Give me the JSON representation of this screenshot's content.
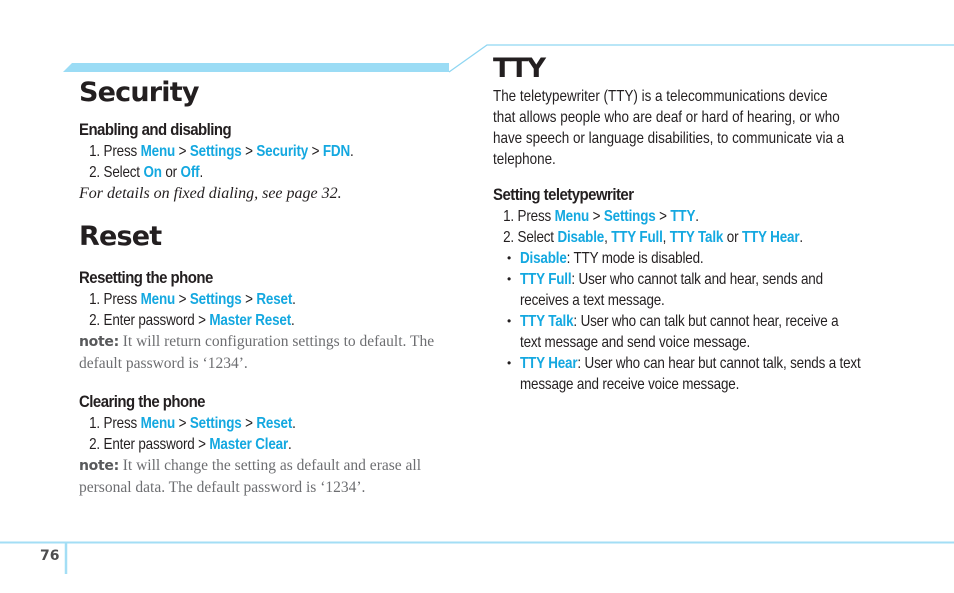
{
  "colors": {
    "accent": "#14a8e0",
    "band": "#9bdcf5",
    "rule": "#8fd6f2",
    "text": "#231f20",
    "note_text": "#6d6e71"
  },
  "left": {
    "security": {
      "title": "Security",
      "subsections": [
        {
          "heading": "Enabling and disabling",
          "steps": [
            {
              "num": "1.",
              "parts": [
                {
                  "t": "Press ",
                  "hl": false
                },
                {
                  "t": "Menu",
                  "hl": true
                },
                {
                  "t": " > ",
                  "hl": false
                },
                {
                  "t": "Settings",
                  "hl": true
                },
                {
                  "t": " > ",
                  "hl": false
                },
                {
                  "t": "Security",
                  "hl": true
                },
                {
                  "t": " > ",
                  "hl": false
                },
                {
                  "t": "FDN",
                  "hl": true
                },
                {
                  "t": ".",
                  "hl": false
                }
              ]
            },
            {
              "num": "2.",
              "parts": [
                {
                  "t": "Select ",
                  "hl": false
                },
                {
                  "t": "On",
                  "hl": true
                },
                {
                  "t": " or ",
                  "hl": false
                },
                {
                  "t": "Off",
                  "hl": true
                },
                {
                  "t": ".",
                  "hl": false
                }
              ]
            }
          ],
          "italic_note": "For details on fixed dialing, see page 32."
        }
      ]
    },
    "reset": {
      "title": "Reset",
      "subsections": [
        {
          "heading": "Resetting the phone",
          "steps": [
            {
              "num": "1.",
              "parts": [
                {
                  "t": "Press ",
                  "hl": false
                },
                {
                  "t": "Menu",
                  "hl": true
                },
                {
                  "t": " > ",
                  "hl": false
                },
                {
                  "t": "Settings",
                  "hl": true
                },
                {
                  "t": " > ",
                  "hl": false
                },
                {
                  "t": "Reset",
                  "hl": true
                },
                {
                  "t": ".",
                  "hl": false
                }
              ]
            },
            {
              "num": "2.",
              "parts": [
                {
                  "t": "Enter password > ",
                  "hl": false
                },
                {
                  "t": "Master Reset",
                  "hl": true
                },
                {
                  "t": ".",
                  "hl": false
                }
              ]
            }
          ],
          "note_label": "note:",
          "note_lines": [
            " It will return configuration settings to default. The",
            "default password is ‘1234’."
          ]
        },
        {
          "heading": "Clearing the phone",
          "steps": [
            {
              "num": "1.",
              "parts": [
                {
                  "t": "Press ",
                  "hl": false
                },
                {
                  "t": "Menu",
                  "hl": true
                },
                {
                  "t": " > ",
                  "hl": false
                },
                {
                  "t": "Settings",
                  "hl": true
                },
                {
                  "t": " > ",
                  "hl": false
                },
                {
                  "t": "Reset",
                  "hl": true
                },
                {
                  "t": ".",
                  "hl": false
                }
              ]
            },
            {
              "num": "2.",
              "parts": [
                {
                  "t": "Enter password > ",
                  "hl": false
                },
                {
                  "t": "Master Clear",
                  "hl": true
                },
                {
                  "t": ".",
                  "hl": false
                }
              ]
            }
          ],
          "note_label": "note:",
          "note_lines": [
            " It will change the setting as default and erase all",
            "personal data. The default password is ‘1234’."
          ]
        }
      ]
    }
  },
  "right": {
    "title": "TTY",
    "intro_lines": [
      "The teletypewriter (TTY) is a telecommunications device",
      "that allows people who are deaf or hard of hearing, or who",
      "have speech or language disabilities, to communicate via a",
      "telephone."
    ],
    "heading": "Setting teletypewriter",
    "steps": [
      {
        "num": "1.",
        "parts": [
          {
            "t": "Press ",
            "hl": false
          },
          {
            "t": "Menu",
            "hl": true
          },
          {
            "t": " > ",
            "hl": false
          },
          {
            "t": "Settings",
            "hl": true
          },
          {
            "t": " > ",
            "hl": false
          },
          {
            "t": "TTY",
            "hl": true
          },
          {
            "t": ".",
            "hl": false
          }
        ]
      },
      {
        "num": "2.",
        "parts": [
          {
            "t": "Select ",
            "hl": false
          },
          {
            "t": "Disable",
            "hl": true
          },
          {
            "t": ", ",
            "hl": false
          },
          {
            "t": "TTY Full",
            "hl": true
          },
          {
            "t": ", ",
            "hl": false
          },
          {
            "t": "TTY Talk",
            "hl": true
          },
          {
            "t": " or ",
            "hl": false
          },
          {
            "t": "TTY Hear",
            "hl": true
          },
          {
            "t": ".",
            "hl": false
          }
        ]
      }
    ],
    "bullets": [
      {
        "term": "Disable",
        "lines": [
          ": TTY mode is disabled."
        ]
      },
      {
        "term": "TTY Full",
        "lines": [
          ": User who cannot talk and hear, sends and",
          "receives a text message."
        ]
      },
      {
        "term": "TTY Talk",
        "lines": [
          ": User who can talk but cannot hear, receive a",
          "text message and send voice message."
        ]
      },
      {
        "term": "TTY Hear",
        "lines": [
          ": User who can hear but cannot talk, sends a text",
          "message and receive voice message."
        ]
      }
    ]
  },
  "footer": {
    "page_number": "76"
  }
}
